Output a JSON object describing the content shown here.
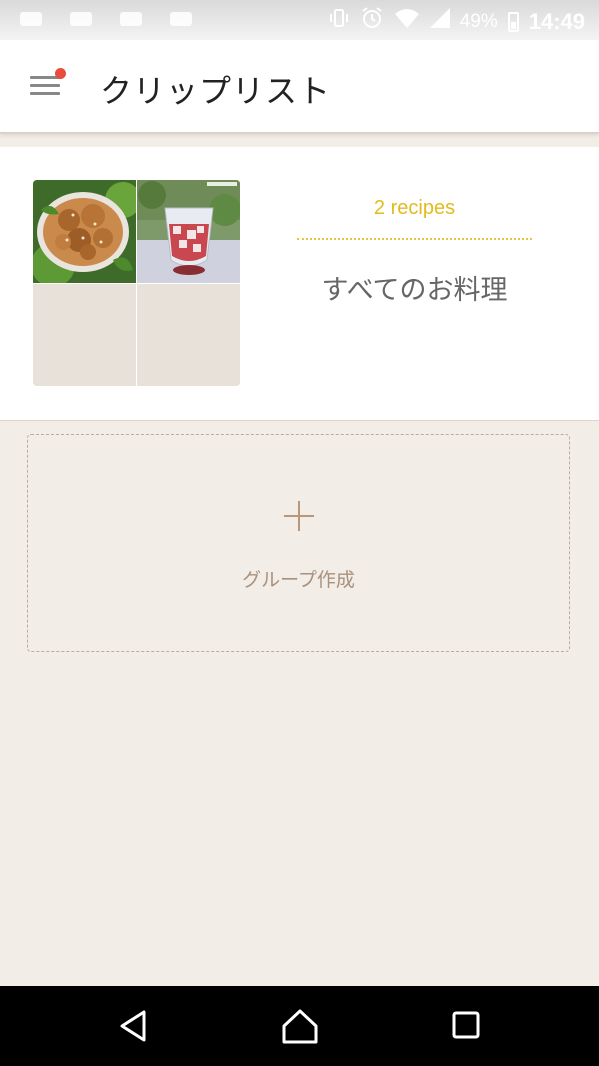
{
  "status_bar": {
    "battery_percent": "49%",
    "time": "14:49",
    "icons": [
      "vibrate-icon",
      "alarm-icon",
      "wifi-icon",
      "signal-icon",
      "battery-icon"
    ]
  },
  "app_bar": {
    "title": "クリップリスト",
    "menu_icon": "hamburger-menu-icon",
    "notification_dot_color": "#e84c3d"
  },
  "clip_groups": [
    {
      "recipe_count": "2 recipes",
      "name": "すべてのお料理",
      "thumbnails": [
        {
          "description_icon": "fried-chicken-photo"
        },
        {
          "description_icon": "dessert-glass-photo"
        },
        {
          "description_icon": "empty-thumbnail"
        },
        {
          "description_icon": "empty-thumbnail"
        }
      ]
    }
  ],
  "create_group": {
    "label": "グループ作成",
    "icon": "plus-icon"
  },
  "nav_bar": {
    "icons": [
      "back-icon",
      "home-icon",
      "recent-apps-icon"
    ]
  },
  "colors": {
    "background": "#f2ede7",
    "accent_yellow": "#e2bb1e",
    "accent_brown": "#b8967a"
  }
}
